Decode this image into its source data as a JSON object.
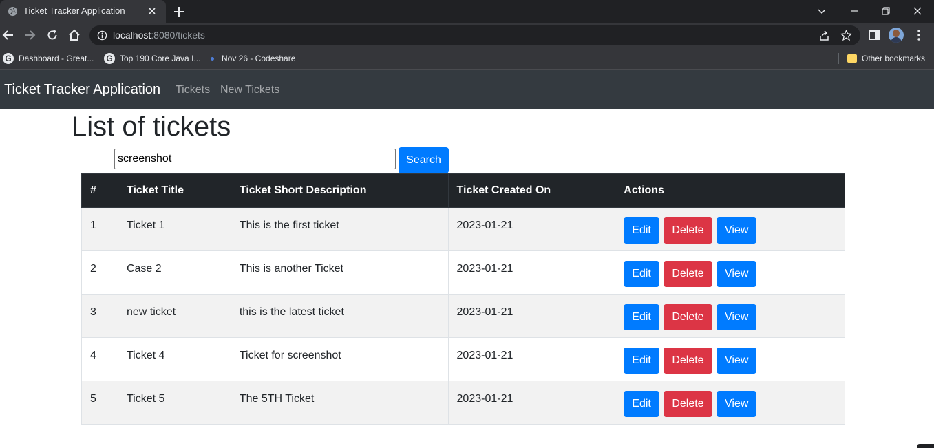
{
  "browser": {
    "tab_title": "Ticket Tracker Application",
    "url_host": "localhost",
    "url_rest": ":8080/tickets",
    "bookmarks": [
      {
        "label": "Dashboard - Great...",
        "icon": "google-g-icon"
      },
      {
        "label": "Top 190 Core Java I...",
        "icon": "google-g-icon"
      },
      {
        "label": "Nov 26 - Codeshare",
        "icon": "dot-icon"
      }
    ],
    "other_bookmarks": "Other bookmarks"
  },
  "navbar": {
    "brand": "Ticket Tracker Application",
    "links": [
      "Tickets",
      "New Tickets"
    ]
  },
  "page": {
    "title": "List of tickets"
  },
  "search": {
    "value": "screenshot",
    "button_label": "Search"
  },
  "table": {
    "headers": [
      "#",
      "Ticket Title",
      "Ticket Short Description",
      "Ticket Created On",
      "Actions"
    ],
    "rows": [
      {
        "id": "1",
        "title": "Ticket 1",
        "description": "This is the first ticket",
        "created": "2023-01-21"
      },
      {
        "id": "2",
        "title": "Case 2",
        "description": "This is another Ticket",
        "created": "2023-01-21"
      },
      {
        "id": "3",
        "title": "new ticket",
        "description": "this is the latest ticket",
        "created": "2023-01-21"
      },
      {
        "id": "4",
        "title": "Ticket 4",
        "description": "Ticket for screenshot",
        "created": "2023-01-21"
      },
      {
        "id": "5",
        "title": "Ticket 5",
        "description": "The 5TH Ticket",
        "created": "2023-01-21"
      }
    ],
    "actions": {
      "edit": "Edit",
      "delete": "Delete",
      "view": "View"
    }
  },
  "colors": {
    "primary": "#007bff",
    "danger": "#dc3545",
    "navbar": "#343a40",
    "table_header": "#212529"
  }
}
